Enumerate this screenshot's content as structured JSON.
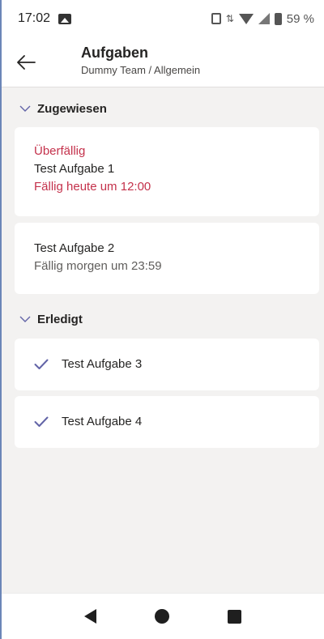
{
  "status_bar": {
    "time": "17:02",
    "battery": "59 %"
  },
  "header": {
    "title": "Aufgaben",
    "subtitle": "Dummy Team / Allgemein"
  },
  "sections": {
    "assigned": {
      "label": "Zugewiesen",
      "tasks": [
        {
          "status": "Überfällig",
          "title": "Test Aufgabe 1",
          "due": "Fällig heute um 12:00"
        },
        {
          "title": "Test Aufgabe 2",
          "due": "Fällig morgen um 23:59"
        }
      ]
    },
    "done": {
      "label": "Erledigt",
      "tasks": [
        {
          "title": "Test Aufgabe 3"
        },
        {
          "title": "Test Aufgabe 4"
        }
      ]
    }
  },
  "colors": {
    "overdue": "#c4314b",
    "accent": "#6264a7"
  }
}
